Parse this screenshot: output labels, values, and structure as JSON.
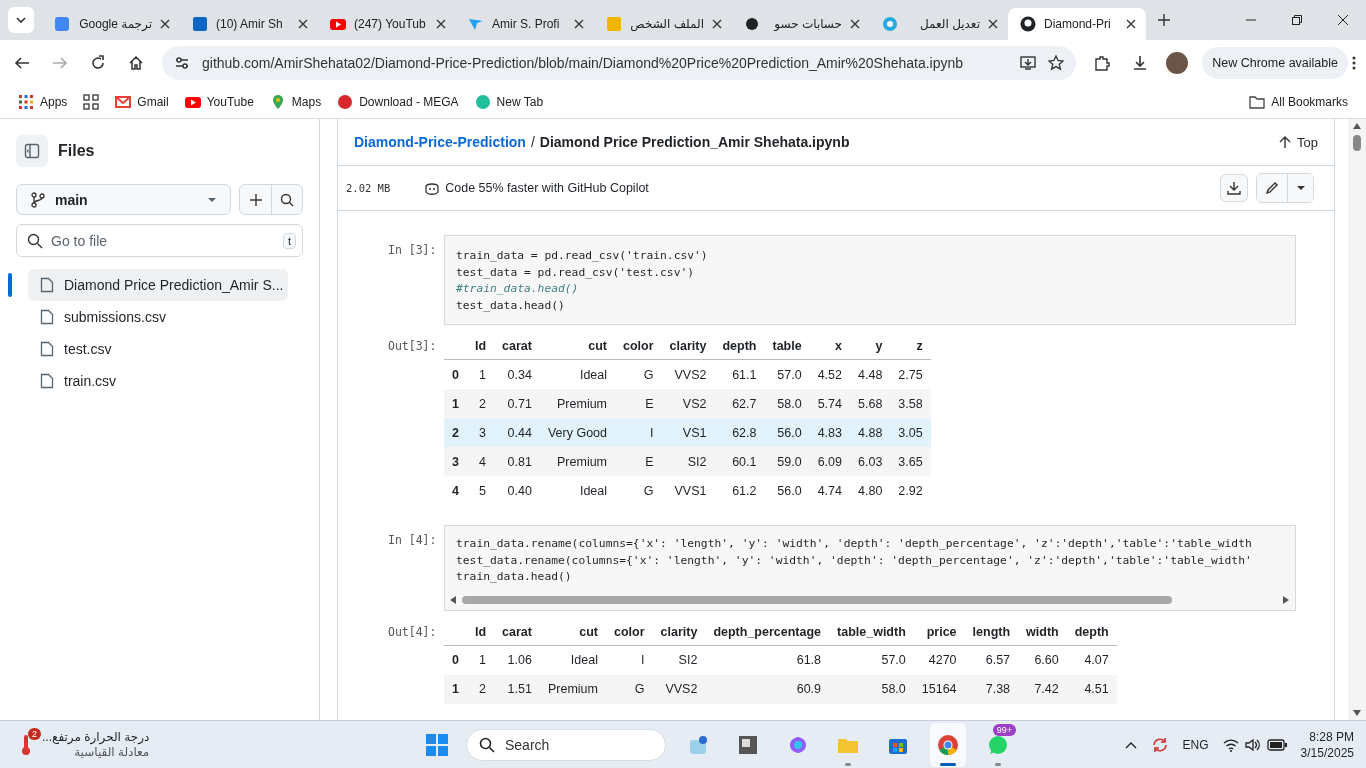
{
  "browser": {
    "tabs": [
      {
        "title": "ترجمة Google",
        "kind": "google",
        "selected": false
      },
      {
        "title": "(10) Amir Sh",
        "kind": "linkedin",
        "selected": false
      },
      {
        "title": "(247) YouTub",
        "kind": "youtube",
        "selected": false
      },
      {
        "title": "Amir S. Profi",
        "kind": "bird",
        "selected": false
      },
      {
        "title": "الملف الشخص",
        "kind": "number",
        "selected": false
      },
      {
        "title": "حسابات حسو",
        "kind": "dot",
        "selected": false
      },
      {
        "title": "تعديل العمل",
        "kind": "ring",
        "selected": false
      },
      {
        "title": "Diamond-Pri",
        "kind": "github",
        "selected": true
      }
    ],
    "address": "github.com/AmirShehata02/Diamond-Price-Prediction/blob/main/Diamond%20Price%20Prediction_Amir%20Shehata.ipynb",
    "update": "New Chrome available",
    "bookmarks": [
      {
        "label": "Apps",
        "kind": "apps"
      },
      {
        "label": "Gmail",
        "kind": "mail"
      },
      {
        "label": "YouTube",
        "kind": "youtube"
      },
      {
        "label": "Maps",
        "kind": "pin"
      },
      {
        "label": "Download - MEGA",
        "kind": "mega"
      },
      {
        "label": "New Tab",
        "kind": "m"
      }
    ],
    "all_bookmarks": "All Bookmarks"
  },
  "sidebar": {
    "title": "Files",
    "branch": "main",
    "search_placeholder": "Go to file",
    "shortcut": "t",
    "files": [
      {
        "name": "Diamond Price Prediction_Amir S...",
        "selected": true
      },
      {
        "name": "submissions.csv",
        "selected": false
      },
      {
        "name": "test.csv",
        "selected": false
      },
      {
        "name": "train.csv",
        "selected": false
      }
    ]
  },
  "header": {
    "repo": "Diamond-Price-Prediction",
    "separator": "/",
    "file": "Diamond Price Prediction_Amir Shehata.ipynb",
    "top": "Top",
    "size": "2.02 MB",
    "copilot": "Code 55% faster with GitHub Copilot"
  },
  "cells": [
    {
      "kind": "code",
      "prompt": "In [3]:",
      "scrollable": false,
      "lines": [
        {
          "text": "train_data = pd.read_csv('train.csv')",
          "kind": "code"
        },
        {
          "text": "test_data = pd.read_csv('test.csv')",
          "kind": "code"
        },
        {
          "text": "#train_data.head()",
          "kind": "comment"
        },
        {
          "text": "test_data.head()",
          "kind": "code"
        }
      ]
    },
    {
      "kind": "table",
      "prompt": "Out[3]:",
      "columns": [
        "Id",
        "carat",
        "cut",
        "color",
        "clarity",
        "depth",
        "table",
        "x",
        "y",
        "z"
      ],
      "rows": [
        {
          "index": "0",
          "highlighted": false,
          "cells": [
            "1",
            "0.34",
            "Ideal",
            "G",
            "VVS2",
            "61.1",
            "57.0",
            "4.52",
            "4.48",
            "2.75"
          ]
        },
        {
          "index": "1",
          "highlighted": false,
          "cells": [
            "2",
            "0.71",
            "Premium",
            "E",
            "VS2",
            "62.7",
            "58.0",
            "5.74",
            "5.68",
            "3.58"
          ]
        },
        {
          "index": "2",
          "highlighted": true,
          "cells": [
            "3",
            "0.44",
            "Very Good",
            "I",
            "VS1",
            "62.8",
            "56.0",
            "4.83",
            "4.88",
            "3.05"
          ]
        },
        {
          "index": "3",
          "highlighted": false,
          "cells": [
            "4",
            "0.81",
            "Premium",
            "E",
            "SI2",
            "60.1",
            "59.0",
            "6.09",
            "6.03",
            "3.65"
          ]
        },
        {
          "index": "4",
          "highlighted": false,
          "cells": [
            "5",
            "0.40",
            "Ideal",
            "G",
            "VVS1",
            "61.2",
            "56.0",
            "4.74",
            "4.80",
            "2.92"
          ]
        }
      ]
    },
    {
      "kind": "code",
      "prompt": "In [4]:",
      "scrollable": true,
      "lines": [
        {
          "text": "train_data.rename(columns={'x': 'length', 'y': 'width', 'depth': 'depth_percentage', 'z':'depth','table':'table_width",
          "kind": "code"
        },
        {
          "text": "test_data.rename(columns={'x': 'length', 'y': 'width', 'depth': 'depth_percentage', 'z':'depth','table':'table_width'",
          "kind": "code"
        },
        {
          "text": "train_data.head()",
          "kind": "code"
        }
      ]
    },
    {
      "kind": "table",
      "prompt": "Out[4]:",
      "columns": [
        "Id",
        "carat",
        "cut",
        "color",
        "clarity",
        "depth_percentage",
        "table_width",
        "price",
        "length",
        "width",
        "depth"
      ],
      "rows": [
        {
          "index": "0",
          "highlighted": false,
          "cells": [
            "1",
            "1.06",
            "Ideal",
            "I",
            "SI2",
            "61.8",
            "57.0",
            "4270",
            "6.57",
            "6.60",
            "4.07"
          ]
        },
        {
          "index": "1",
          "highlighted": false,
          "cells": [
            "2",
            "1.51",
            "Premium",
            "G",
            "VVS2",
            "60.9",
            "58.0",
            "15164",
            "7.38",
            "7.42",
            "4.51"
          ]
        }
      ]
    }
  ],
  "taskbar": {
    "weather": {
      "title": "درجة الحرارة مرتفع...",
      "subtitle": "معادلة القياسية",
      "badge": "2"
    },
    "search": "Search",
    "apps": [
      {
        "kind": "widget",
        "running": false,
        "selected": false
      },
      {
        "kind": "gallery",
        "running": false,
        "selected": false
      },
      {
        "kind": "copilot",
        "running": false,
        "selected": false
      },
      {
        "kind": "folder",
        "running": true,
        "selected": false
      },
      {
        "kind": "store",
        "running": false,
        "selected": false
      },
      {
        "kind": "chrome",
        "running": true,
        "selected": true
      },
      {
        "kind": "chat",
        "running": true,
        "selected": false,
        "badge": "99+"
      }
    ],
    "language": "ENG",
    "time": "8:28 PM",
    "date": "3/15/2025"
  }
}
